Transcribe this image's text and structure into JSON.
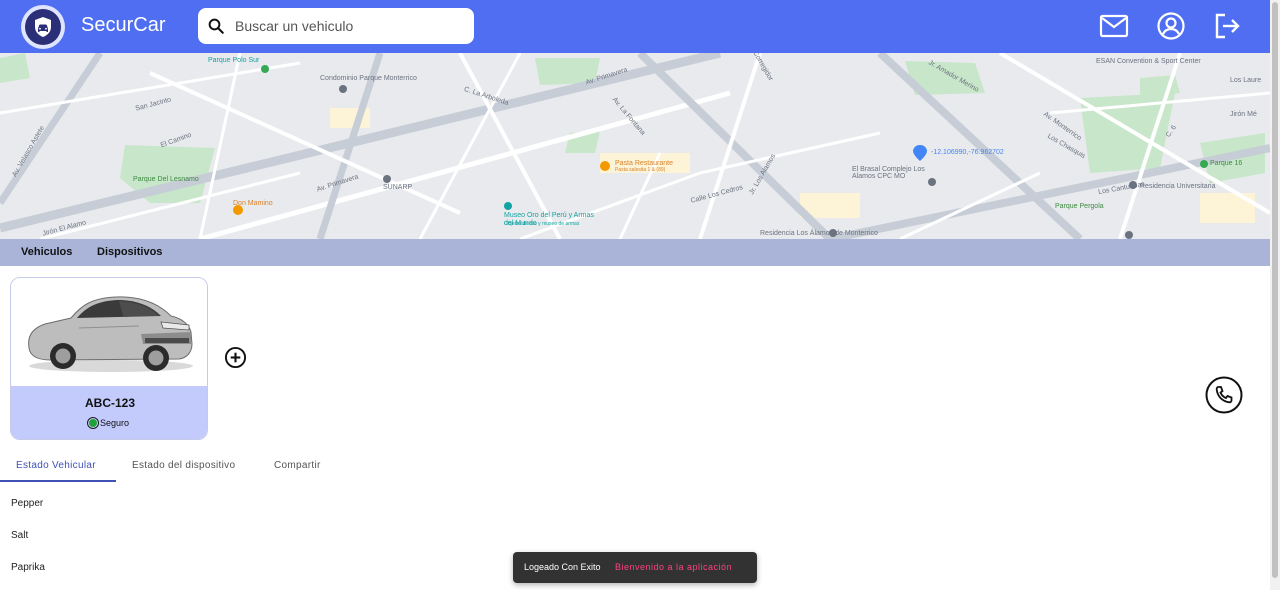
{
  "header": {
    "brand": "SecurCar",
    "logo_icon": "shield-car-icon",
    "search_placeholder": "Buscar un vehiculo",
    "search_value": "",
    "actions": [
      {
        "icon": "mail-icon"
      },
      {
        "icon": "account-circle-icon"
      },
      {
        "icon": "logout-icon"
      }
    ],
    "color": "#4f6ef2"
  },
  "map": {
    "labels": [
      "Parque Polo Sur",
      "Condominio Parque Monterrico",
      "C. La Arboleda",
      "Av. Primavera",
      "Av. Primavera",
      "San Jacinto",
      "El Corregidor",
      "Av. La Fontana",
      "Jr. Los Alamos",
      "Calle Los Cedros",
      "El Camino",
      "Parque Del Lesnamo",
      "Los Cantuarias",
      "Jr. Amador Merino",
      "Av. Monterrico",
      "Jirón Mé",
      "C. 6",
      "Parque Pergola",
      "Residencia Universitaria",
      "ESAN Convention & Sport Center",
      "Los Laure",
      "Av. Velasco Astete",
      "Jirón El Alamo",
      "Los Chasquis"
    ],
    "pois": [
      {
        "name": "Pasta Restaurante",
        "subtitle": "Pasta salesita 1 & (89)"
      },
      {
        "name": "SUNARP"
      },
      {
        "name": "Museo Oro del Perú y Armas del Mundo",
        "subtitle": "Objetos de oro y museo de armas"
      },
      {
        "name": "Don Mamino"
      },
      {
        "name": "El Brasal Complejo Los Alamos CPC MO"
      },
      {
        "name": "-12.106990,-76.962702"
      },
      {
        "name": "Residencia Los Álamos de Monterrico"
      },
      {
        "name": "Parque 16"
      }
    ]
  },
  "nav": {
    "items": [
      "Vehiculos",
      "Dispositivos"
    ],
    "color": "#a9b4d8"
  },
  "vehicle": {
    "plate": "ABC-123",
    "status": "Seguro",
    "status_color": "#1fa23a",
    "card_color": "#c3cafc"
  },
  "tabs": {
    "items": [
      "Estado Vehicular",
      "Estado del dispositivo",
      "Compartir"
    ],
    "active": 0,
    "accent": "#3f51b5"
  },
  "list": [
    "Pepper",
    "Salt",
    "Paprika"
  ],
  "snackbar": {
    "message": "Logeado Con Exito",
    "action": "Bienvenido a la aplicación",
    "action_color": "#ff4081"
  }
}
